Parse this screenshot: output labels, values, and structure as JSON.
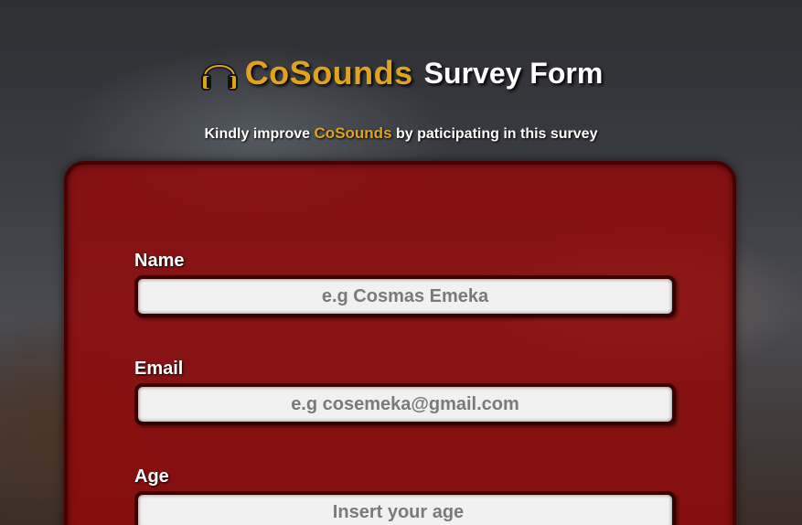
{
  "header": {
    "brand": "CoSounds",
    "title_rest": "Survey Form",
    "icon": "headphone-icon"
  },
  "subtitle": {
    "prefix": "Kindly improve",
    "brand": "CoSounds",
    "suffix": "by paticipating in this survey"
  },
  "form": {
    "fields": [
      {
        "label": "Name",
        "placeholder": "e.g Cosmas Emeka",
        "value": ""
      },
      {
        "label": "Email",
        "placeholder": "e.g cosemeka@gmail.com",
        "value": ""
      },
      {
        "label": "Age",
        "placeholder": "Insert your age",
        "value": ""
      }
    ]
  },
  "colors": {
    "brand": "#e0a41c",
    "card": "#960808",
    "card_border": "#4a0000"
  }
}
